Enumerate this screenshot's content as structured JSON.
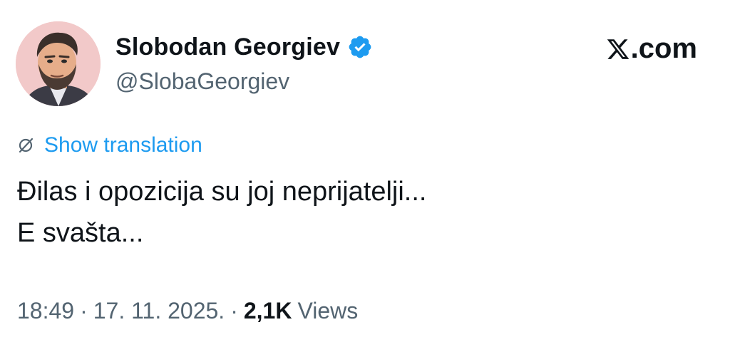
{
  "author": {
    "display_name": "Slobodan Georgiev",
    "handle": "@SlobaGeorgiev",
    "verified": true,
    "avatar_icon": "profile-photo-avatar"
  },
  "site_label": ".com",
  "site_logo_icon": "x-logo-icon",
  "translation": {
    "icon": "globe-slash-icon",
    "label": "Show translation"
  },
  "tweet": {
    "lines": [
      "Đilas i opozicija su joj neprijatelji...",
      "E svašta..."
    ]
  },
  "meta": {
    "time": "18:49",
    "separator": "·",
    "date": "17. 11. 2025.",
    "views_count": "2,1K",
    "views_label": "Views"
  },
  "colors": {
    "text_primary": "#0f1419",
    "text_secondary": "#536471",
    "link_blue": "#1d9bf0",
    "verified_blue": "#1d9bf0",
    "avatar_bg": "#f2c9c9"
  }
}
